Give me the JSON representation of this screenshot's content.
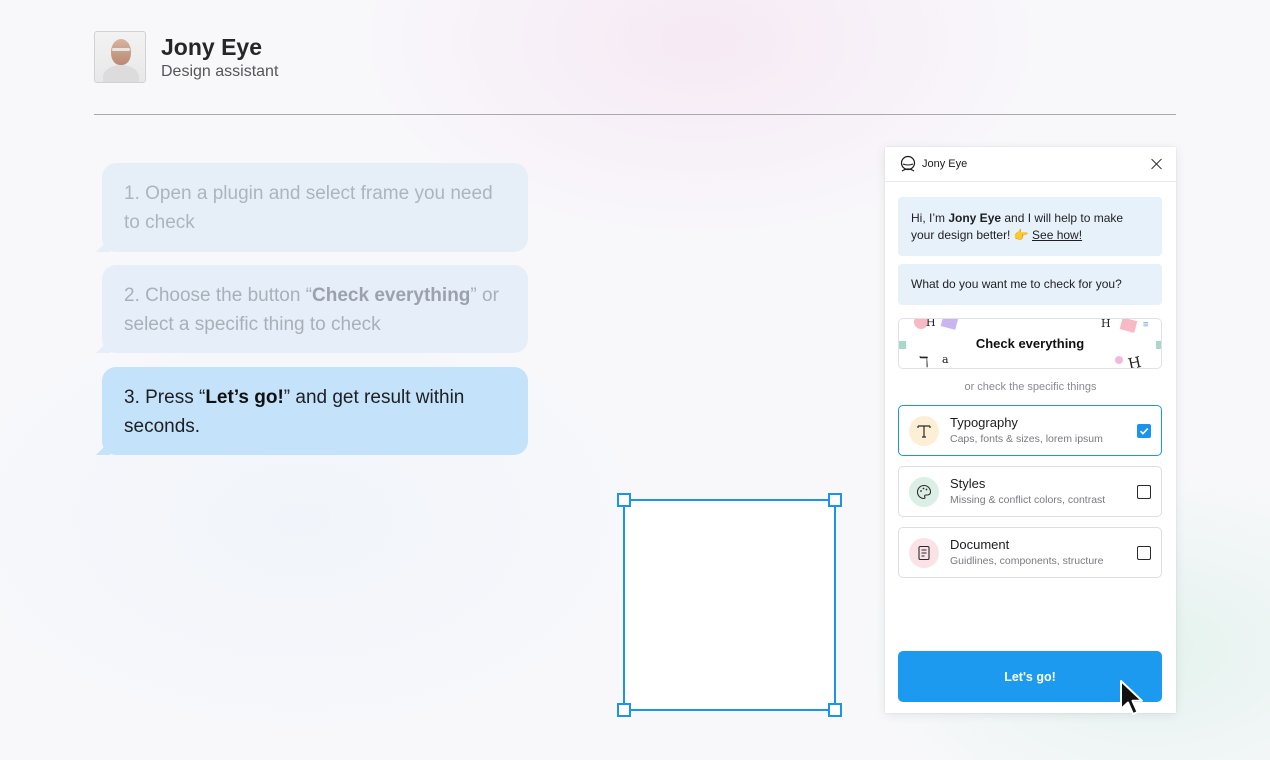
{
  "header": {
    "title": "Jony Eye",
    "subtitle": "Design assistant"
  },
  "steps": [
    {
      "prefix": "1. Open a plugin and select frame you need to check"
    },
    {
      "pre": "2. Choose the button “",
      "bold": "Check everything",
      "post": "” or select a specific thing to check"
    },
    {
      "pre": "3. Press “",
      "bold": "Let’s go!",
      "post": "” and get result within seconds."
    }
  ],
  "plugin": {
    "title": "Jony Eye",
    "greeting": {
      "pre": "Hi, I’m ",
      "bold": "Jony Eye",
      "mid": " and I will help to make your design better! 👉 ",
      "link": "See how!"
    },
    "question": "What do you want me to check for you?",
    "check_all": "Check everything",
    "or_text": "or check the specific things",
    "options": [
      {
        "title": "Typography",
        "subtitle": "Caps, fonts & sizes, lorem ipsum",
        "checked": true,
        "icon": "typography-icon",
        "icon_bg": "#fcefd6"
      },
      {
        "title": "Styles",
        "subtitle": "Missing & conflict colors, contrast",
        "checked": false,
        "icon": "palette-icon",
        "icon_bg": "#dcefe6"
      },
      {
        "title": "Document",
        "subtitle": "Guidlines, components, structure",
        "checked": false,
        "icon": "document-icon",
        "icon_bg": "#fbe2e6"
      }
    ],
    "go_label": "Let's go!"
  },
  "colors": {
    "accent": "#1b94ee",
    "bubble_active": "#c4e2fa",
    "bubble_inactive": "#e6eff8"
  }
}
